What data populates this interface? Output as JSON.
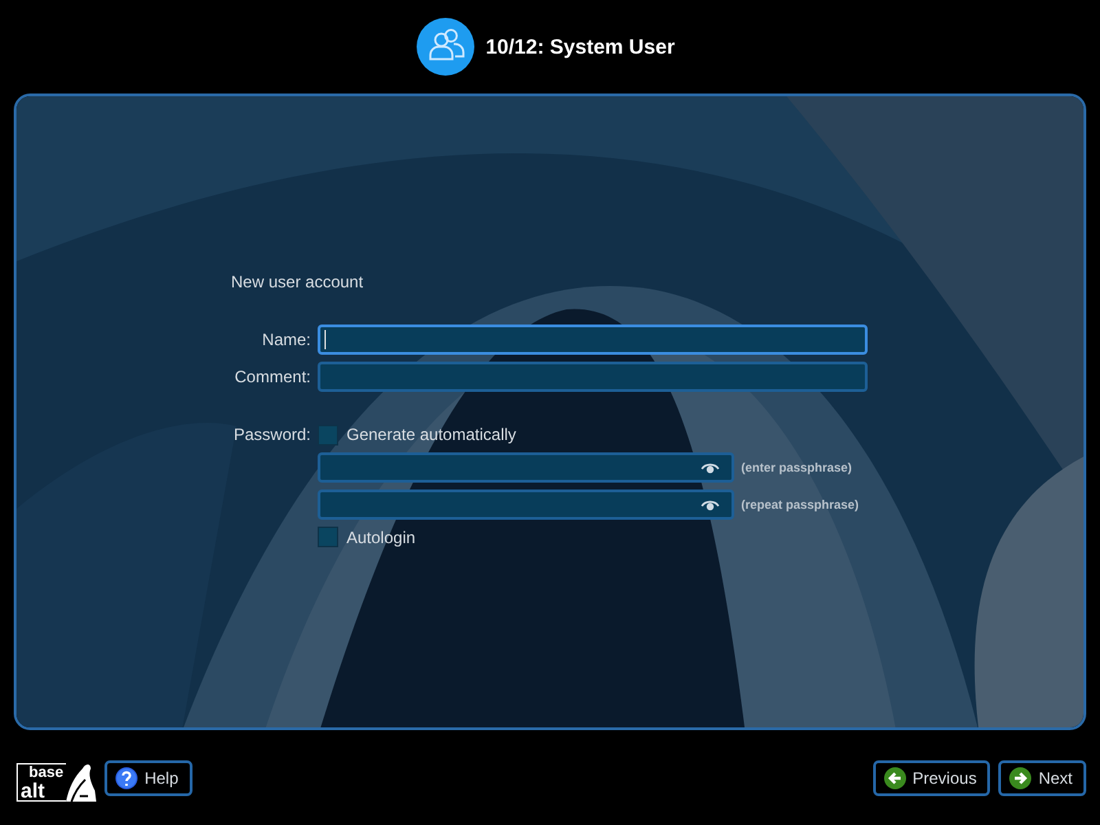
{
  "header": {
    "title": "10/12: System User"
  },
  "form": {
    "section_title": "New user account",
    "fields": [
      {
        "label": "Name:",
        "focused": true
      },
      {
        "label": "Comment:",
        "focused": false
      }
    ],
    "password": {
      "label": "Password:",
      "generate": {
        "label": "Generate automatically",
        "checked": false
      },
      "entries": [
        {
          "hint": "(enter passphrase)"
        },
        {
          "hint": "(repeat passphrase)"
        }
      ],
      "autologin": {
        "label": "Autologin",
        "checked": false
      }
    }
  },
  "footer": {
    "logo": {
      "top": "base",
      "bottom": "alt"
    },
    "buttons": [
      {
        "label": "Help",
        "kind": "help"
      },
      {
        "label": "Previous",
        "kind": "back"
      },
      {
        "label": "Next",
        "kind": "forward"
      }
    ]
  }
}
